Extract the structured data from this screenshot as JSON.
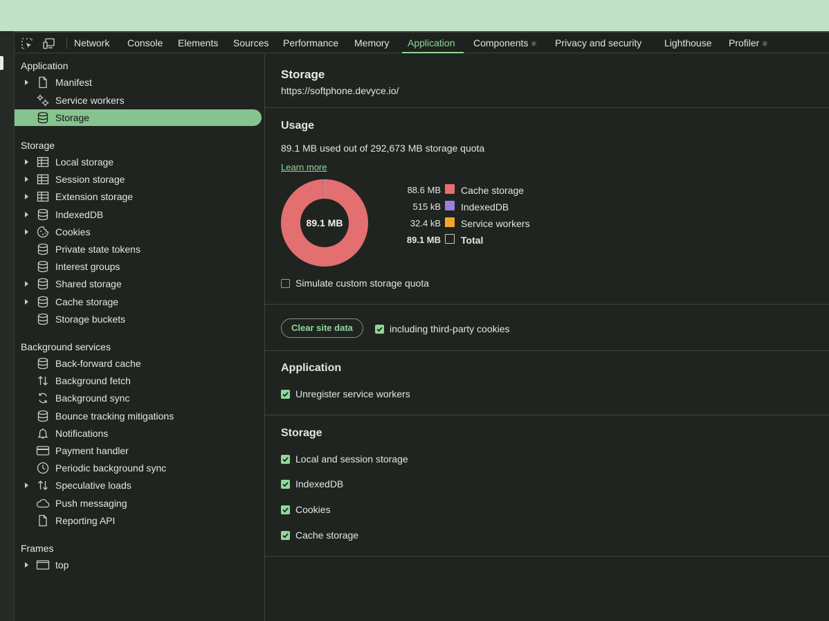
{
  "tabs": [
    {
      "label": "Network"
    },
    {
      "label": "Console"
    },
    {
      "label": "Elements"
    },
    {
      "label": "Sources"
    },
    {
      "label": "Performance"
    },
    {
      "label": "Memory"
    },
    {
      "label": "Application",
      "active": true
    },
    {
      "label": "Components",
      "suffix_icon": "gear-icon"
    },
    {
      "label": "Privacy and security"
    },
    {
      "label": "Lighthouse"
    },
    {
      "label": "Profiler",
      "suffix_icon": "gear-icon"
    }
  ],
  "sidebar": {
    "application": {
      "title": "Application",
      "items": [
        {
          "label": "Manifest",
          "icon": "file-icon",
          "expandable": true
        },
        {
          "label": "Service workers",
          "icon": "gears-icon"
        },
        {
          "label": "Storage",
          "icon": "database-icon",
          "selected": true
        }
      ]
    },
    "storage": {
      "title": "Storage",
      "items": [
        {
          "label": "Local storage",
          "icon": "table-icon",
          "expandable": true
        },
        {
          "label": "Session storage",
          "icon": "table-icon",
          "expandable": true
        },
        {
          "label": "Extension storage",
          "icon": "table-icon",
          "expandable": true
        },
        {
          "label": "IndexedDB",
          "icon": "database-icon",
          "expandable": true
        },
        {
          "label": "Cookies",
          "icon": "cookie-icon",
          "expandable": true
        },
        {
          "label": "Private state tokens",
          "icon": "database-icon"
        },
        {
          "label": "Interest groups",
          "icon": "database-icon"
        },
        {
          "label": "Shared storage",
          "icon": "database-icon",
          "expandable": true
        },
        {
          "label": "Cache storage",
          "icon": "database-icon",
          "expandable": true
        },
        {
          "label": "Storage buckets",
          "icon": "database-icon"
        }
      ]
    },
    "background": {
      "title": "Background services",
      "items": [
        {
          "label": "Back-forward cache",
          "icon": "database-icon"
        },
        {
          "label": "Background fetch",
          "icon": "up-down-arrows-icon"
        },
        {
          "label": "Background sync",
          "icon": "sync-icon"
        },
        {
          "label": "Bounce tracking mitigations",
          "icon": "database-icon"
        },
        {
          "label": "Notifications",
          "icon": "bell-icon"
        },
        {
          "label": "Payment handler",
          "icon": "card-icon"
        },
        {
          "label": "Periodic background sync",
          "icon": "clock-icon"
        },
        {
          "label": "Speculative loads",
          "icon": "up-down-arrows-icon",
          "expandable": true
        },
        {
          "label": "Push messaging",
          "icon": "cloud-icon"
        },
        {
          "label": "Reporting API",
          "icon": "file-icon"
        }
      ]
    },
    "frames": {
      "title": "Frames",
      "items": [
        {
          "label": "top",
          "icon": "frame-icon",
          "expandable": true
        }
      ]
    }
  },
  "main": {
    "title": "Storage",
    "origin": "https://softphone.devyce.io/",
    "usage": {
      "heading": "Usage",
      "summary": "89.1 MB used out of 292,673 MB storage quota",
      "learn_more": "Learn more",
      "donut_center": "89.1 MB",
      "legend": [
        {
          "value": "88.6 MB",
          "name": "Cache storage",
          "color": "#e46f70"
        },
        {
          "value": "515 kB",
          "name": "IndexedDB",
          "color": "#9a7ee0"
        },
        {
          "value": "32.4 kB",
          "name": "Service workers",
          "color": "#f3a62c"
        },
        {
          "value": "89.1 MB",
          "name": "Total",
          "color": "transparent",
          "bold": true
        }
      ],
      "simulate_label": "Simulate custom storage quota",
      "simulate_checked": false
    },
    "clear": {
      "button_label": "Clear site data",
      "third_party_label": "including third-party cookies",
      "third_party_checked": true
    },
    "application_section": {
      "heading": "Application",
      "options": [
        {
          "label": "Unregister service workers",
          "checked": true
        }
      ]
    },
    "storage_section": {
      "heading": "Storage",
      "options": [
        {
          "label": "Local and session storage",
          "checked": true
        },
        {
          "label": "IndexedDB",
          "checked": true
        },
        {
          "label": "Cookies",
          "checked": true
        },
        {
          "label": "Cache storage",
          "checked": true
        }
      ]
    }
  },
  "chart_data": {
    "type": "pie",
    "categories": [
      "Cache storage",
      "IndexedDB",
      "Service workers"
    ],
    "values": [
      88.6,
      0.515,
      0.0324
    ],
    "unit": "MB",
    "center_label": "89.1 MB"
  }
}
